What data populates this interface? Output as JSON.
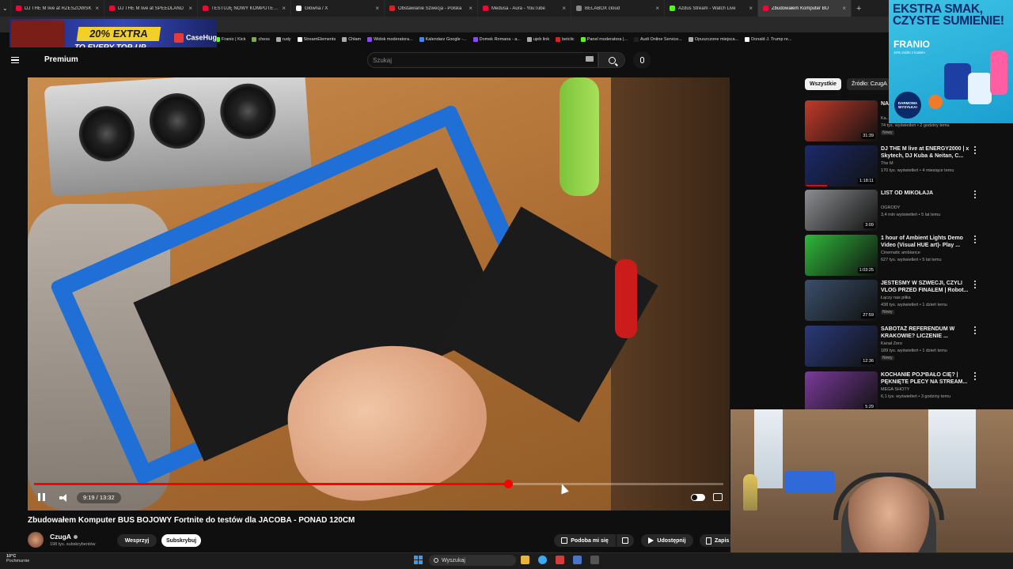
{
  "browser": {
    "tabs": [
      {
        "label": "DJ THE M live at RZESZOWSK",
        "favicon_color": "#ff0033",
        "active": false
      },
      {
        "label": "DJ THE M live at SPEEDLAND",
        "favicon_color": "#ff0033",
        "active": false
      },
      {
        "label": "TESTUJĘ NOWY KOMPUTER z",
        "favicon_color": "#ff0033",
        "active": false
      },
      {
        "label": "Główna / X",
        "favicon_color": "#ffffff",
        "active": false
      },
      {
        "label": "Obstawianie Szwecja - Polska",
        "favicon_color": "#e02020",
        "active": false
      },
      {
        "label": "Medusa - Aura - YouTube",
        "favicon_color": "#ff0033",
        "active": false
      },
      {
        "label": "BELABOX cloud",
        "favicon_color": "#888888",
        "active": false
      },
      {
        "label": "Azdus Stream - Watch Live",
        "favicon_color": "#53fc18",
        "active": false
      },
      {
        "label": "Zbudowałem Komputer BU",
        "favicon_color": "#ff0033",
        "active": true
      }
    ],
    "new_tab": "+",
    "bookmarks": [
      {
        "label": "Franio | Kick",
        "color": "#53fc18"
      },
      {
        "label": "chess",
        "color": "#7fa650"
      },
      {
        "label": "rudy",
        "color": "#aaaaaa"
      },
      {
        "label": "StreamElements",
        "color": "#ffffff"
      },
      {
        "label": "Chłam",
        "color": "#aaaaaa"
      },
      {
        "label": "Widok moderatora...",
        "color": "#9146ff"
      },
      {
        "label": "Kalendarz Google -...",
        "color": "#4285f4"
      },
      {
        "label": "Domek Romana - a...",
        "color": "#9146ff"
      },
      {
        "label": "ujeb link",
        "color": "#aaaaaa"
      },
      {
        "label": "betclic",
        "color": "#e02020"
      },
      {
        "label": "Panel moderatora |...",
        "color": "#53fc18"
      },
      {
        "label": "Audi Online Service...",
        "color": "#222222"
      },
      {
        "label": "Opuszczone miejsca...",
        "color": "#aaaaaa"
      },
      {
        "label": "Donald J. Trump re...",
        "color": "#ffffff"
      }
    ]
  },
  "promo": {
    "discount": "20% EXTRA",
    "subtitle": "TO EVERY TOP-UP",
    "brand": "CaseHug"
  },
  "youtube": {
    "logo_text": "Premium",
    "search_placeholder": "Szukaj"
  },
  "player": {
    "current_time": "9:19",
    "duration": "13:32",
    "time_display": "9:19 / 13:32",
    "progress_fraction": 0.688,
    "autoplay_on": true
  },
  "video": {
    "title": "Zbudowałem Komputer BUS BOJOWY Fortnite do testów dla JACOBA - PONAD 120CM",
    "channel": "CzugA",
    "subscribers": "198 tys. subskrybentów",
    "support_label": "Wesprzyj",
    "subscribe_label": "Subskrybuj",
    "like_label": "Podoba mi się",
    "share_label": "Udostępnij",
    "save_label": "Zapis"
  },
  "sidebar": {
    "chips": [
      "Wszystkie",
      "Źródło: CzugA"
    ],
    "recommendations": [
      {
        "title": "NA... SE...",
        "channel": "Ka...",
        "meta": "74 tys. wyświetleń • 2 godziny temu",
        "badge": "Nowy",
        "duration": "31:39",
        "thumb_color": "#c23a2a",
        "watched_fraction": 0
      },
      {
        "title": "DJ THE M live at ENERGY2000 | x Skytech, DJ Kuba & Neitan, C...",
        "channel": "The M",
        "meta": "170 tys. wyświetleń • 4 miesiące temu",
        "badge": "",
        "duration": "1:18:11",
        "thumb_color": "#1b2a6b",
        "watched_fraction": 0.3
      },
      {
        "title": "LIST OD MIKOŁAJA",
        "channel": "OGRODY",
        "meta": "3,4 mln wyświetleń • 5 lat temu",
        "badge": "",
        "duration": "3:09",
        "thumb_color": "#8b8d90",
        "watched_fraction": 0
      },
      {
        "title": "1 hour of Ambient Lights Demo Video (Visual HUE art)- Play ...",
        "channel": "Cinematic ambiance",
        "meta": "627 tys. wyświetleń • 5 lat temu",
        "badge": "",
        "duration": "1:03:25",
        "thumb_color": "#2fb83a",
        "watched_fraction": 0
      },
      {
        "title": "JESTEŚMY W SZWECJI, CZYLI VLOG PRZED FINAŁEM | Robot...",
        "channel": "Łączy nas piłka",
        "meta": "438 tys. wyświetleń • 1 dzień temu",
        "badge": "Nowy",
        "duration": "27:59",
        "thumb_color": "#3a4f6a",
        "watched_fraction": 0
      },
      {
        "title": "SABOTAŻ REFERENDUM W KRAKOWIE? LICZENIE ...",
        "channel": "Kanał Zero",
        "meta": "189 tys. wyświetleń • 1 dzień temu",
        "badge": "Nowy",
        "duration": "12:36",
        "thumb_color": "#2a3a7a",
        "watched_fraction": 0
      },
      {
        "title": "KOCHANIE POJ*BAŁO CIĘ? | PĘKNIĘTE PLECY NA STREAM...",
        "channel": "MEGA SHOTY",
        "meta": "6,1 tys. wyświetleń • 3 godziny temu",
        "badge": "",
        "duration": "5:29",
        "thumb_color": "#7a3a9a",
        "watched_fraction": 0
      }
    ]
  },
  "sponsor_ad": {
    "headline": "EKSTRA SMAK, CZYSTE SUMIENIE!",
    "brand": "FRANIO",
    "fine_print": "10% zniżki z kodem",
    "badge": "DARMOWA WYSYŁKA!"
  },
  "taskbar": {
    "temperature": "10°C",
    "condition": "Pochmurnie",
    "search_label": "Wyszukaj"
  }
}
